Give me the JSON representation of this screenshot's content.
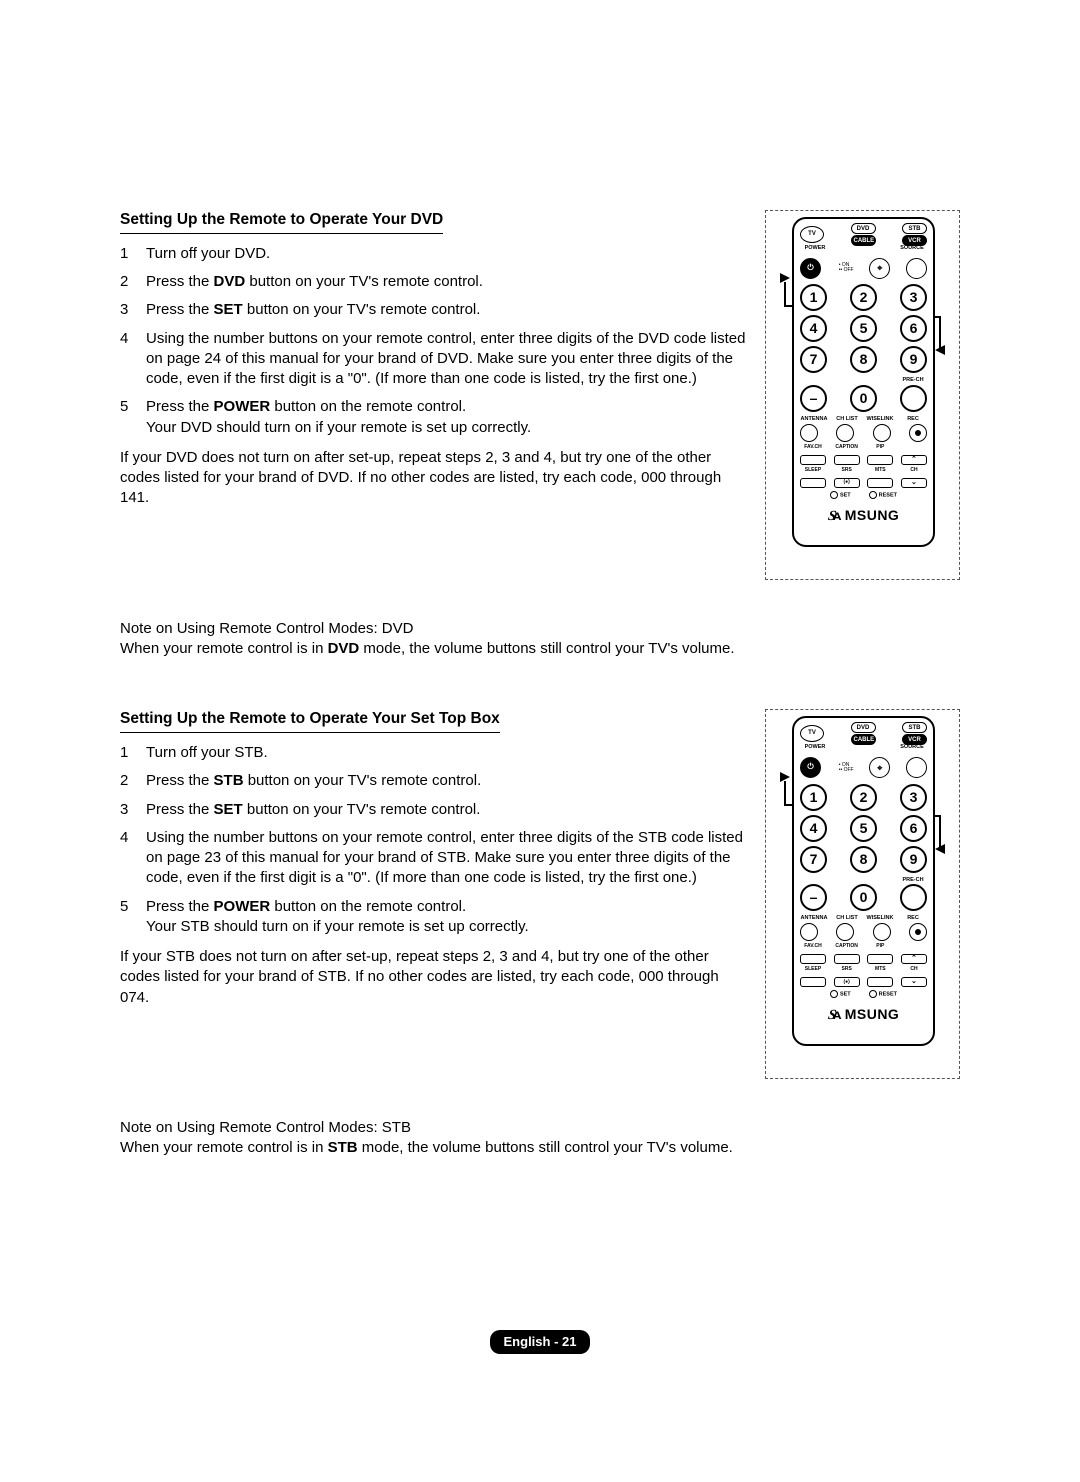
{
  "sections": [
    {
      "heading": "Setting Up the Remote to Operate Your DVD",
      "steps": [
        {
          "n": "1",
          "t": "Turn off your DVD."
        },
        {
          "n": "2",
          "t_pre": "Press the ",
          "bold": "DVD",
          "t_post": " button on your TV's remote control."
        },
        {
          "n": "3",
          "t_pre": "Press the ",
          "bold": "SET",
          "t_post": " button on your TV's remote control."
        },
        {
          "n": "4",
          "t": "Using the number buttons on your remote control, enter three digits of the DVD code listed on page 24 of this manual for your brand of DVD. Make sure you enter three digits of the code, even if the first digit is a \"0\". (If more than one code is listed, try the first one.)"
        },
        {
          "n": "5",
          "t_pre": "Press the ",
          "bold": "POWER",
          "t_post": " button on the remote control.",
          "extra": "Your DVD should turn on if your remote is set up correctly."
        }
      ],
      "followup": "If your DVD does not turn on after set-up, repeat steps 2, 3 and 4, but try one of the other codes listed for your brand of DVD. If no other codes are listed, try each code, 000 through 141.",
      "note_title": "Note on Using Remote Control Modes: DVD",
      "note_pre": "When your remote control is in ",
      "note_bold": "DVD",
      "note_post": " mode, the volume buttons still control your TV's volume."
    },
    {
      "heading": "Setting Up the Remote to Operate Your Set Top Box",
      "steps": [
        {
          "n": "1",
          "t": "Turn off your STB."
        },
        {
          "n": "2",
          "t_pre": "Press the ",
          "bold": "STB",
          "t_post": " button on your TV's remote control."
        },
        {
          "n": "3",
          "t_pre": "Press the ",
          "bold": "SET",
          "t_post": " button on your TV's remote control."
        },
        {
          "n": "4",
          "t": "Using the number buttons on your remote control, enter three digits of the STB code listed on page 23 of this manual for your brand of STB. Make sure you enter three digits of the code, even if the first digit is a \"0\". (If more than one code is listed, try the first one.)"
        },
        {
          "n": "5",
          "t_pre": "Press the ",
          "bold": "POWER",
          "t_post": " button on the remote control.",
          "extra": "Your STB should turn on if your remote is set up correctly."
        }
      ],
      "followup": "If your STB does not turn on after set-up, repeat steps 2, 3 and 4, but try one of the other codes listed for your brand of STB. If no other codes are listed, try each code, 000 through 074.",
      "note_title": "Note on Using Remote Control Modes: STB",
      "note_pre": "When your remote control is in ",
      "note_bold": "STB",
      "note_post": " mode, the volume buttons still control your TV's volume."
    }
  ],
  "remote": {
    "modes": {
      "tv": "TV",
      "dvd": "DVD",
      "stb": "STB",
      "cable": "CABLE",
      "vcr": "VCR"
    },
    "labels": {
      "power": "POWER",
      "source": "SOURCE",
      "on": "ON",
      "off": "OFF",
      "precn": "PRE-CH",
      "antenna": "ANTENNA",
      "chlist": "CH LIST",
      "wiselink": "WISELINK",
      "rec": "REC",
      "favch": "FAV.CH",
      "caption": "CAPTION",
      "pip": "PIP",
      "sleep": "SLEEP",
      "srs": "SRS",
      "mts": "MTS",
      "ch": "CH",
      "set": "SET",
      "reset": "RESET",
      "minus": "–"
    },
    "numbers": [
      "1",
      "2",
      "3",
      "4",
      "5",
      "6",
      "7",
      "8",
      "9",
      "0"
    ],
    "brand": "MSUNG"
  },
  "footer": "English - 21"
}
